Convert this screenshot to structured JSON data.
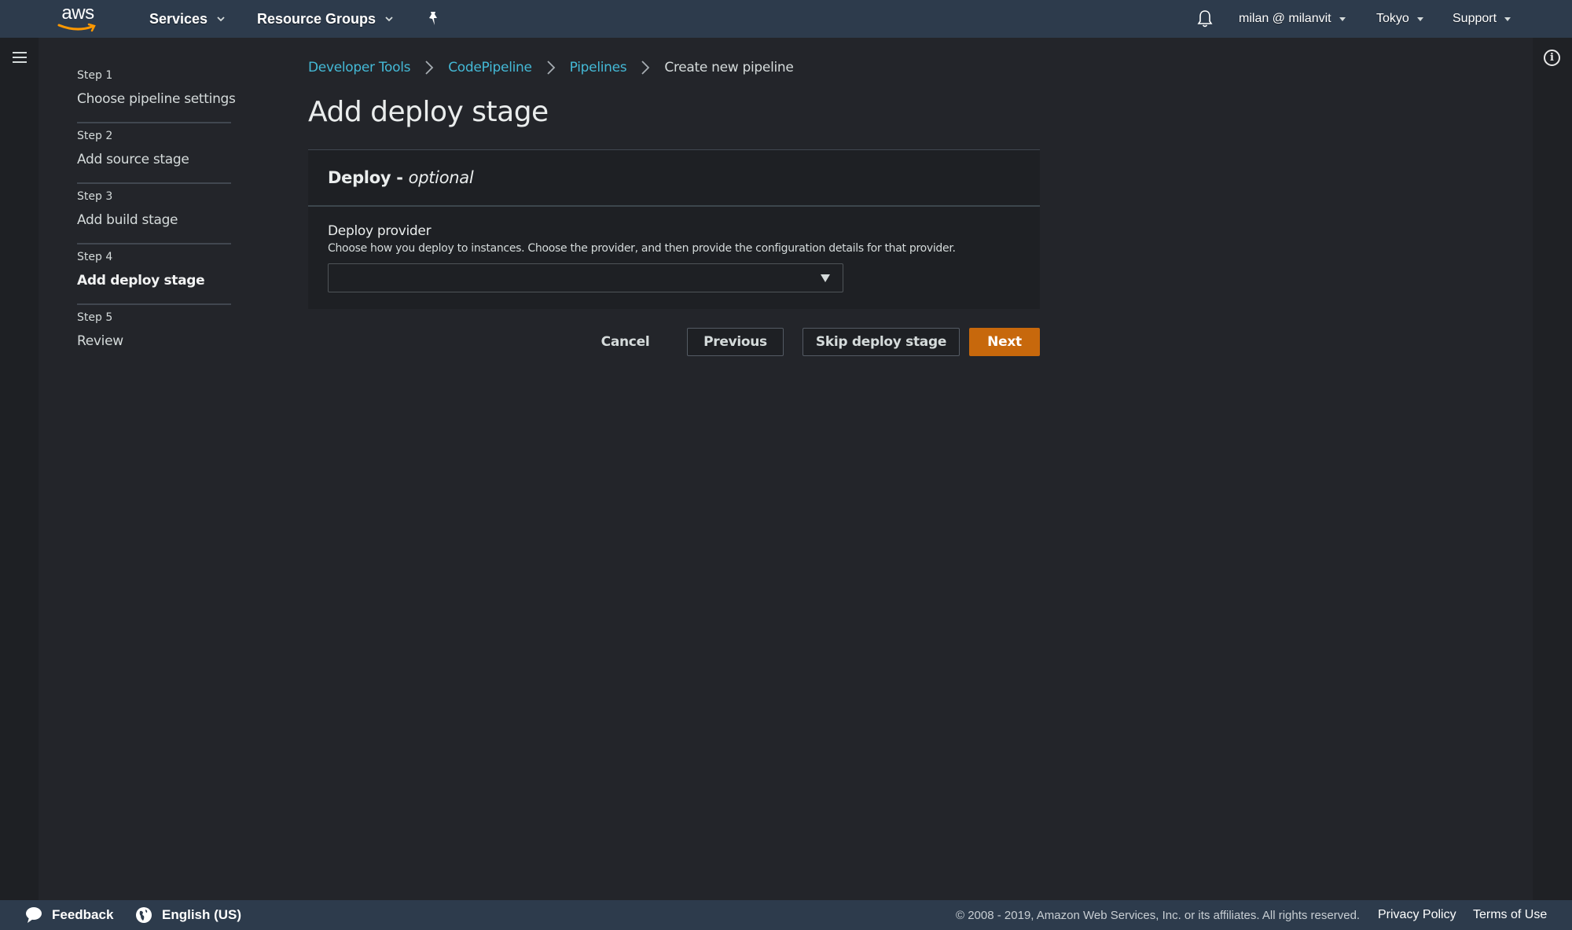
{
  "topnav": {
    "logo": "aws",
    "services_label": "Services",
    "resource_groups_label": "Resource Groups",
    "pin_icon": "pushpin-icon",
    "bell_icon": "bell-icon",
    "account_label": "milan @ milanvit",
    "region_label": "Tokyo",
    "support_label": "Support"
  },
  "steps": [
    {
      "number": "Step 1",
      "title": "Choose pipeline settings",
      "active": false
    },
    {
      "number": "Step 2",
      "title": "Add source stage",
      "active": false
    },
    {
      "number": "Step 3",
      "title": "Add build stage",
      "active": false
    },
    {
      "number": "Step 4",
      "title": "Add deploy stage",
      "active": true
    },
    {
      "number": "Step 5",
      "title": "Review",
      "active": false
    }
  ],
  "breadcrumb": {
    "items": [
      "Developer Tools",
      "CodePipeline",
      "Pipelines"
    ],
    "current": "Create new pipeline"
  },
  "page_title": "Add deploy stage",
  "panel": {
    "title": "Deploy - ",
    "title_suffix": "optional",
    "field_label": "Deploy provider",
    "field_description": "Choose how you deploy to instances. Choose the provider, and then provide the configuration details for that provider.",
    "select_value": ""
  },
  "actions": {
    "cancel": "Cancel",
    "previous": "Previous",
    "skip": "Skip deploy stage",
    "next": "Next"
  },
  "footer": {
    "feedback": "Feedback",
    "language": "English (US)",
    "copyright": "© 2008 - 2019, Amazon Web Services, Inc. or its affiliates. All rights reserved.",
    "privacy": "Privacy Policy",
    "terms": "Terms of Use"
  },
  "colors": {
    "accent_link": "#44b9d6",
    "primary_button": "#c7680c",
    "nav_bg": "#2d3b4c",
    "page_bg": "#23252a"
  }
}
